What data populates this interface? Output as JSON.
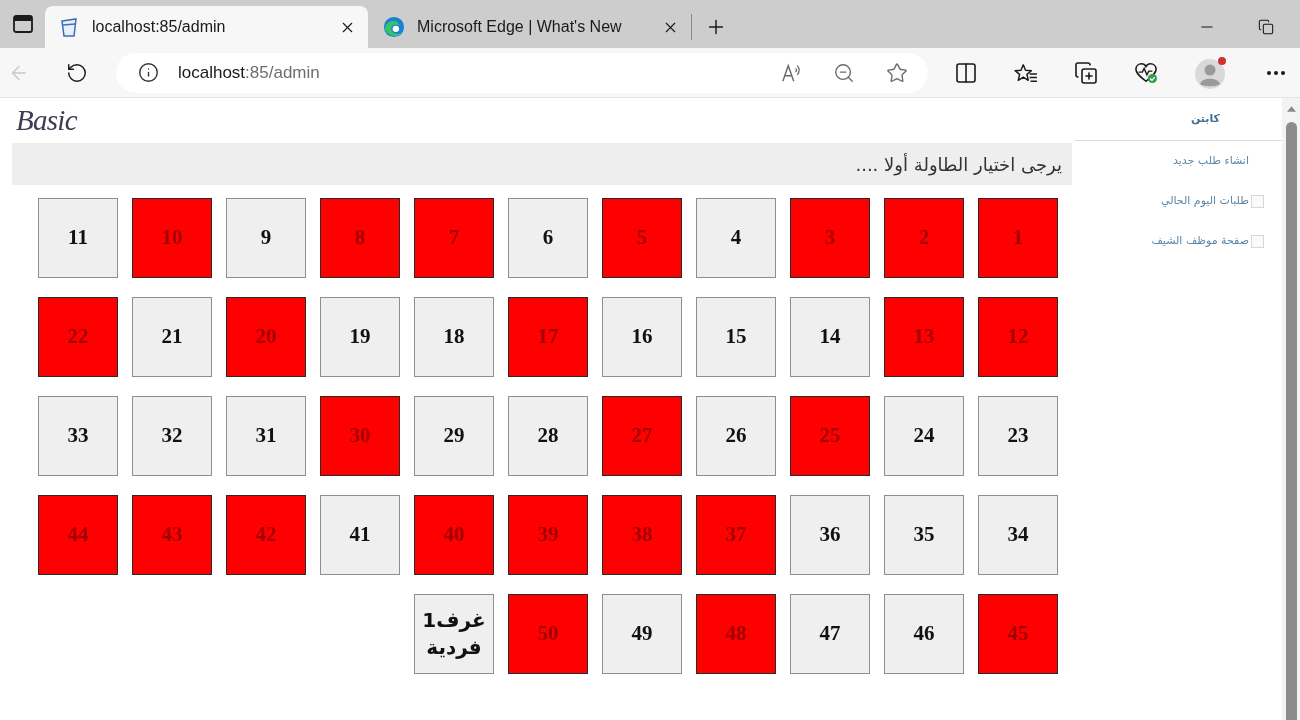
{
  "browser": {
    "left_tab": {
      "title": "localhost:85/admin",
      "selected": true,
      "kind": "page"
    },
    "right_tab": {
      "title": "Microsoft Edge | What's New",
      "selected": false,
      "kind": "edge"
    },
    "back_disabled": true,
    "address": {
      "host": "localhost",
      "path": ":85/admin"
    }
  },
  "page": {
    "logo": "Basic",
    "notice": "يرجى اختيار الطاولة أولا ....",
    "sidebar": {
      "title": "كابتن",
      "items": [
        {
          "label": "انشاء طلب جديد",
          "kind": "plain"
        },
        {
          "label": "طلبات اليوم الحالي",
          "kind": "icon"
        },
        {
          "label": "صفحة موظف الشيف",
          "kind": "icon"
        }
      ]
    },
    "tables": [
      {
        "label": "1",
        "occupied": true,
        "kind": "table"
      },
      {
        "label": "2",
        "occupied": true,
        "kind": "table"
      },
      {
        "label": "3",
        "occupied": true,
        "kind": "table"
      },
      {
        "label": "4",
        "occupied": false,
        "kind": "table"
      },
      {
        "label": "5",
        "occupied": true,
        "kind": "table"
      },
      {
        "label": "6",
        "occupied": false,
        "kind": "table"
      },
      {
        "label": "7",
        "occupied": true,
        "kind": "table"
      },
      {
        "label": "8",
        "occupied": true,
        "kind": "table"
      },
      {
        "label": "9",
        "occupied": false,
        "kind": "table"
      },
      {
        "label": "10",
        "occupied": true,
        "kind": "table"
      },
      {
        "label": "11",
        "occupied": false,
        "kind": "table"
      },
      {
        "label": "12",
        "occupied": true,
        "kind": "table"
      },
      {
        "label": "13",
        "occupied": true,
        "kind": "table"
      },
      {
        "label": "14",
        "occupied": false,
        "kind": "table"
      },
      {
        "label": "15",
        "occupied": false,
        "kind": "table"
      },
      {
        "label": "16",
        "occupied": false,
        "kind": "table"
      },
      {
        "label": "17",
        "occupied": true,
        "kind": "table"
      },
      {
        "label": "18",
        "occupied": false,
        "kind": "table"
      },
      {
        "label": "19",
        "occupied": false,
        "kind": "table"
      },
      {
        "label": "20",
        "occupied": true,
        "kind": "table"
      },
      {
        "label": "21",
        "occupied": false,
        "kind": "table"
      },
      {
        "label": "22",
        "occupied": true,
        "kind": "table"
      },
      {
        "label": "23",
        "occupied": false,
        "kind": "table"
      },
      {
        "label": "24",
        "occupied": false,
        "kind": "table"
      },
      {
        "label": "25",
        "occupied": true,
        "kind": "table"
      },
      {
        "label": "26",
        "occupied": false,
        "kind": "table"
      },
      {
        "label": "27",
        "occupied": true,
        "kind": "table"
      },
      {
        "label": "28",
        "occupied": false,
        "kind": "table"
      },
      {
        "label": "29",
        "occupied": false,
        "kind": "table"
      },
      {
        "label": "30",
        "occupied": true,
        "kind": "table"
      },
      {
        "label": "31",
        "occupied": false,
        "kind": "table"
      },
      {
        "label": "32",
        "occupied": false,
        "kind": "table"
      },
      {
        "label": "33",
        "occupied": false,
        "kind": "table"
      },
      {
        "label": "34",
        "occupied": false,
        "kind": "table"
      },
      {
        "label": "35",
        "occupied": false,
        "kind": "table"
      },
      {
        "label": "36",
        "occupied": false,
        "kind": "table"
      },
      {
        "label": "37",
        "occupied": true,
        "kind": "table"
      },
      {
        "label": "38",
        "occupied": true,
        "kind": "table"
      },
      {
        "label": "39",
        "occupied": true,
        "kind": "table"
      },
      {
        "label": "40",
        "occupied": true,
        "kind": "table"
      },
      {
        "label": "41",
        "occupied": false,
        "kind": "table"
      },
      {
        "label": "42",
        "occupied": true,
        "kind": "table"
      },
      {
        "label": "43",
        "occupied": true,
        "kind": "table"
      },
      {
        "label": "44",
        "occupied": true,
        "kind": "table"
      },
      {
        "label": "45",
        "occupied": true,
        "kind": "table"
      },
      {
        "label": "46",
        "occupied": false,
        "kind": "table"
      },
      {
        "label": "47",
        "occupied": false,
        "kind": "table"
      },
      {
        "label": "48",
        "occupied": true,
        "kind": "table"
      },
      {
        "label": "49",
        "occupied": false,
        "kind": "table"
      },
      {
        "label": "50",
        "occupied": true,
        "kind": "table"
      },
      {
        "label": "غرف1 فردية",
        "occupied": false,
        "kind": "room"
      }
    ]
  }
}
